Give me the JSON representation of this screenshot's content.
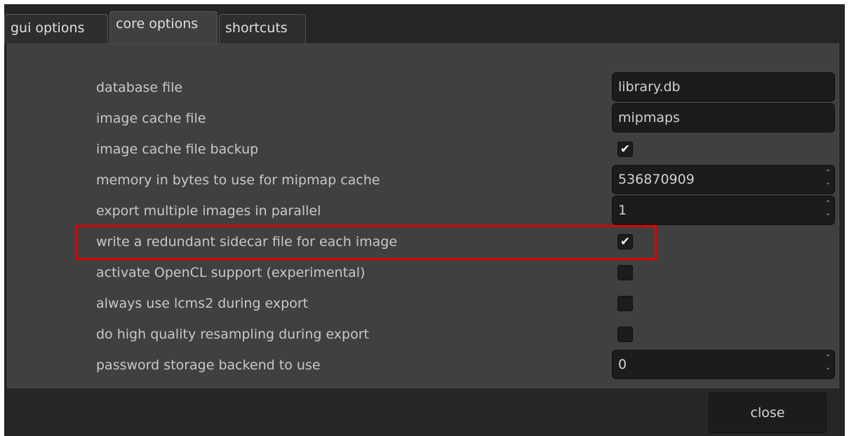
{
  "tabs": [
    {
      "label": "gui options"
    },
    {
      "label": "core options"
    },
    {
      "label": "shortcuts"
    }
  ],
  "active_tab": "core options",
  "options": {
    "database_file": {
      "label": "database file",
      "value": "library.db"
    },
    "image_cache_file": {
      "label": "image cache file",
      "value": "mipmaps"
    },
    "image_cache_backup": {
      "label": "image cache file backup",
      "checked": true
    },
    "mipmap_memory": {
      "label": "memory in bytes to use for mipmap cache",
      "value": "536870909"
    },
    "export_parallel": {
      "label": "export multiple images in parallel",
      "value": "1"
    },
    "sidecar": {
      "label": "write a redundant sidecar file for each image",
      "checked": true
    },
    "opencl": {
      "label": "activate OpenCL support (experimental)",
      "checked": false
    },
    "lcms2": {
      "label": "always use lcms2 during export",
      "checked": false
    },
    "resampling": {
      "label": "do high quality resampling during export",
      "checked": false
    },
    "password_backend": {
      "label": "password storage backend to use",
      "value": "0"
    }
  },
  "check_glyph": "✔",
  "close_label": "close",
  "colors": {
    "highlight": "#e00000",
    "panel": "#404040",
    "background": "#262626"
  }
}
